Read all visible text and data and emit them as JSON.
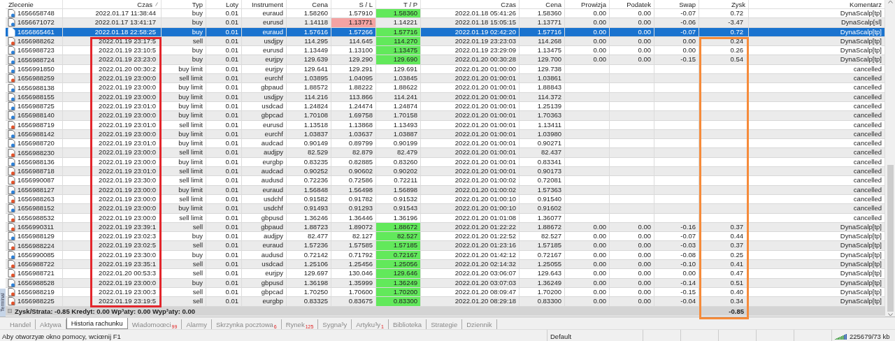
{
  "table": {
    "columns": [
      {
        "label": "Zlecenie",
        "sorted": false,
        "framed": false
      },
      {
        "label": "Czas",
        "sorted": true,
        "framed": true,
        "color": "#e3262c"
      },
      {
        "label": "Typ",
        "sorted": false,
        "framed": false
      },
      {
        "label": "Loty",
        "sorted": false,
        "framed": false
      },
      {
        "label": "Instrument",
        "sorted": false,
        "framed": false
      },
      {
        "label": "Cena",
        "sorted": false,
        "framed": false
      },
      {
        "label": "S / L",
        "sorted": false,
        "framed": false
      },
      {
        "label": "T / P",
        "sorted": false,
        "framed": false
      },
      {
        "label": "Czas",
        "sorted": false,
        "framed": false
      },
      {
        "label": "Cena",
        "sorted": false,
        "framed": false
      },
      {
        "label": "Prowizja",
        "sorted": false,
        "framed": false
      },
      {
        "label": "Podatek",
        "sorted": false,
        "framed": false
      },
      {
        "label": "Swap",
        "sorted": false,
        "framed": false
      },
      {
        "label": "Zysk",
        "sorted": false,
        "framed": true,
        "color": "#f68b3a"
      },
      {
        "label": "Komentarz",
        "sorted": false,
        "framed": false
      }
    ],
    "rows": [
      {
        "kind": "buy",
        "selected": false,
        "order": "1656658748",
        "open_time": "2022.01.17 11:38:44",
        "type": "buy",
        "lots": "0.01",
        "symbol": "euraud",
        "price": "1.58260",
        "sl": "1.57910",
        "sl_hit": false,
        "tp": "1.58360",
        "tp_hit": true,
        "close_time": "2022.01.18 05:41:26",
        "close_price": "1.58360",
        "commission": "0.00",
        "tax": "0.00",
        "swap": "-0.07",
        "profit": "0.72",
        "comment": "DynaScalp[tp]"
      },
      {
        "kind": "buy",
        "selected": false,
        "order": "1656671072",
        "open_time": "2022.01.17 13:41:17",
        "type": "buy",
        "lots": "0.01",
        "symbol": "eurusd",
        "price": "1.14118",
        "sl": "1.13771",
        "sl_hit": true,
        "tp": "1.14221",
        "tp_hit": false,
        "close_time": "2022.01.18 15:05:15",
        "close_price": "1.13771",
        "commission": "0.00",
        "tax": "0.00",
        "swap": "-0.06",
        "profit": "-3.47",
        "comment": "DynaScalp[sl]"
      },
      {
        "kind": "buy",
        "selected": true,
        "order": "1656865461",
        "open_time": "2022.01.18 22:58:25",
        "type": "buy",
        "lots": "0.01",
        "symbol": "euraud",
        "price": "1.57616",
        "sl": "1.57266",
        "sl_hit": false,
        "tp": "1.57716",
        "tp_hit": true,
        "close_time": "2022.01.19 02:42:20",
        "close_price": "1.57716",
        "commission": "0.00",
        "tax": "0.00",
        "swap": "-0.07",
        "profit": "0.72",
        "comment": "DynaScalp[tp]"
      },
      {
        "kind": "sell",
        "selected": false,
        "order": "1656988262",
        "open_time": "2022.01.19 23:17:5",
        "type": "sell",
        "lots": "0.01",
        "symbol": "usdjpy",
        "price": "114.295",
        "sl": "114.645",
        "sl_hit": false,
        "tp": "114.270",
        "tp_hit": true,
        "close_time": "2022.01.19 23:23:03",
        "close_price": "114.268",
        "commission": "0.00",
        "tax": "0.00",
        "swap": "0.00",
        "profit": "0.24",
        "comment": "DynaScalp[tp]"
      },
      {
        "kind": "buy",
        "selected": false,
        "order": "1656988723",
        "open_time": "2022.01.19 23:10:5",
        "type": "buy",
        "lots": "0.01",
        "symbol": "eurusd",
        "price": "1.13449",
        "sl": "1.13100",
        "sl_hit": false,
        "tp": "1.13475",
        "tp_hit": true,
        "close_time": "2022.01.19 23:29:09",
        "close_price": "1.13475",
        "commission": "0.00",
        "tax": "0.00",
        "swap": "0.00",
        "profit": "0.26",
        "comment": "DynaScalp[tp]"
      },
      {
        "kind": "buy",
        "selected": false,
        "order": "1656988724",
        "open_time": "2022.01.19 23:23:0",
        "type": "buy",
        "lots": "0.01",
        "symbol": "eurjpy",
        "price": "129.639",
        "sl": "129.290",
        "sl_hit": false,
        "tp": "129.690",
        "tp_hit": true,
        "close_time": "2022.01.20 00:30:28",
        "close_price": "129.700",
        "commission": "0.00",
        "tax": "0.00",
        "swap": "-0.15",
        "profit": "0.54",
        "comment": "DynaScalp[tp]"
      },
      {
        "kind": "buy",
        "selected": false,
        "order": "1656991850",
        "open_time": "2022.01.20 00:30:2",
        "type": "buy limit",
        "lots": "0.01",
        "symbol": "eurjpy",
        "price": "129.641",
        "sl": "129.291",
        "sl_hit": false,
        "tp": "129.691",
        "tp_hit": false,
        "close_time": "2022.01.20 01:00:00",
        "close_price": "129.738",
        "comment": "cancelled"
      },
      {
        "kind": "sell",
        "selected": false,
        "order": "1656988259",
        "open_time": "2022.01.19 23:00:0",
        "type": "sell limit",
        "lots": "0.01",
        "symbol": "eurchf",
        "price": "1.03895",
        "sl": "1.04095",
        "sl_hit": false,
        "tp": "1.03845",
        "tp_hit": false,
        "close_time": "2022.01.20 01:00:01",
        "close_price": "1.03861",
        "comment": "cancelled"
      },
      {
        "kind": "buy",
        "selected": false,
        "order": "1656988138",
        "open_time": "2022.01.19 23:00:0",
        "type": "buy limit",
        "lots": "0.01",
        "symbol": "gbpaud",
        "price": "1.88572",
        "sl": "1.88222",
        "sl_hit": false,
        "tp": "1.88622",
        "tp_hit": false,
        "close_time": "2022.01.20 01:00:01",
        "close_price": "1.88843",
        "comment": "cancelled"
      },
      {
        "kind": "buy",
        "selected": false,
        "order": "1656988155",
        "open_time": "2022.01.19 23:00:0",
        "type": "buy limit",
        "lots": "0.01",
        "symbol": "usdjpy",
        "price": "114.216",
        "sl": "113.866",
        "sl_hit": false,
        "tp": "114.241",
        "tp_hit": false,
        "close_time": "2022.01.20 01:00:01",
        "close_price": "114.372",
        "comment": "cancelled"
      },
      {
        "kind": "buy",
        "selected": false,
        "order": "1656988725",
        "open_time": "2022.01.19 23:01:0",
        "type": "buy limit",
        "lots": "0.01",
        "symbol": "usdcad",
        "price": "1.24824",
        "sl": "1.24474",
        "sl_hit": false,
        "tp": "1.24874",
        "tp_hit": false,
        "close_time": "2022.01.20 01:00:01",
        "close_price": "1.25139",
        "comment": "cancelled"
      },
      {
        "kind": "buy",
        "selected": false,
        "order": "1656988140",
        "open_time": "2022.01.19 23:00:0",
        "type": "buy limit",
        "lots": "0.01",
        "symbol": "gbpcad",
        "price": "1.70108",
        "sl": "1.69758",
        "sl_hit": false,
        "tp": "1.70158",
        "tp_hit": false,
        "close_time": "2022.01.20 01:00:01",
        "close_price": "1.70363",
        "comment": "cancelled"
      },
      {
        "kind": "sell",
        "selected": false,
        "order": "1656988719",
        "open_time": "2022.01.19 23:01:0",
        "type": "sell limit",
        "lots": "0.01",
        "symbol": "eurusd",
        "price": "1.13518",
        "sl": "1.13868",
        "sl_hit": false,
        "tp": "1.13493",
        "tp_hit": false,
        "close_time": "2022.01.20 01:00:01",
        "close_price": "1.13411",
        "comment": "cancelled"
      },
      {
        "kind": "buy",
        "selected": false,
        "order": "1656988142",
        "open_time": "2022.01.19 23:00:0",
        "type": "buy limit",
        "lots": "0.01",
        "symbol": "eurchf",
        "price": "1.03837",
        "sl": "1.03637",
        "sl_hit": false,
        "tp": "1.03887",
        "tp_hit": false,
        "close_time": "2022.01.20 01:00:01",
        "close_price": "1.03980",
        "comment": "cancelled"
      },
      {
        "kind": "buy",
        "selected": false,
        "order": "1656988720",
        "open_time": "2022.01.19 23:01:0",
        "type": "buy limit",
        "lots": "0.01",
        "symbol": "audcad",
        "price": "0.90149",
        "sl": "0.89799",
        "sl_hit": false,
        "tp": "0.90199",
        "tp_hit": false,
        "close_time": "2022.01.20 01:00:01",
        "close_price": "0.90271",
        "comment": "cancelled"
      },
      {
        "kind": "sell",
        "selected": false,
        "order": "1656988230",
        "open_time": "2022.01.19 23:00:0",
        "type": "sell limit",
        "lots": "0.01",
        "symbol": "audjpy",
        "price": "82.529",
        "sl": "82.879",
        "sl_hit": false,
        "tp": "82.479",
        "tp_hit": false,
        "close_time": "2022.01.20 01:00:01",
        "close_price": "82.437",
        "comment": "cancelled"
      },
      {
        "kind": "buy",
        "selected": false,
        "order": "1656988136",
        "open_time": "2022.01.19 23:00:0",
        "type": "buy limit",
        "lots": "0.01",
        "symbol": "eurgbp",
        "price": "0.83235",
        "sl": "0.82885",
        "sl_hit": false,
        "tp": "0.83260",
        "tp_hit": false,
        "close_time": "2022.01.20 01:00:01",
        "close_price": "0.83341",
        "comment": "cancelled"
      },
      {
        "kind": "sell",
        "selected": false,
        "order": "1656988718",
        "open_time": "2022.01.19 23:01:0",
        "type": "sell limit",
        "lots": "0.01",
        "symbol": "audcad",
        "price": "0.90252",
        "sl": "0.90602",
        "sl_hit": false,
        "tp": "0.90202",
        "tp_hit": false,
        "close_time": "2022.01.20 01:00:01",
        "close_price": "0.90173",
        "comment": "cancelled"
      },
      {
        "kind": "sell",
        "selected": false,
        "order": "1656990087",
        "open_time": "2022.01.19 23:30:0",
        "type": "sell limit",
        "lots": "0.01",
        "symbol": "audusd",
        "price": "0.72236",
        "sl": "0.72586",
        "sl_hit": false,
        "tp": "0.72211",
        "tp_hit": false,
        "close_time": "2022.01.20 01:00:02",
        "close_price": "0.72081",
        "comment": "cancelled"
      },
      {
        "kind": "buy",
        "selected": false,
        "order": "1656988127",
        "open_time": "2022.01.19 23:00:0",
        "type": "buy limit",
        "lots": "0.01",
        "symbol": "euraud",
        "price": "1.56848",
        "sl": "1.56498",
        "sl_hit": false,
        "tp": "1.56898",
        "tp_hit": false,
        "close_time": "2022.01.20 01:00:02",
        "close_price": "1.57363",
        "comment": "cancelled"
      },
      {
        "kind": "sell",
        "selected": false,
        "order": "1656988263",
        "open_time": "2022.01.19 23:00:0",
        "type": "sell limit",
        "lots": "0.01",
        "symbol": "usdchf",
        "price": "0.91582",
        "sl": "0.91782",
        "sl_hit": false,
        "tp": "0.91532",
        "tp_hit": false,
        "close_time": "2022.01.20 01:00:10",
        "close_price": "0.91540",
        "comment": "cancelled"
      },
      {
        "kind": "buy",
        "selected": false,
        "order": "1656988152",
        "open_time": "2022.01.19 23:00:0",
        "type": "buy limit",
        "lots": "0.01",
        "symbol": "usdchf",
        "price": "0.91493",
        "sl": "0.91293",
        "sl_hit": false,
        "tp": "0.91543",
        "tp_hit": false,
        "close_time": "2022.01.20 01:00:10",
        "close_price": "0.91602",
        "comment": "cancelled"
      },
      {
        "kind": "sell",
        "selected": false,
        "order": "1656988532",
        "open_time": "2022.01.19 23:00:0",
        "type": "sell limit",
        "lots": "0.01",
        "symbol": "gbpusd",
        "price": "1.36246",
        "sl": "1.36446",
        "sl_hit": false,
        "tp": "1.36196",
        "tp_hit": false,
        "close_time": "2022.01.20 01:01:08",
        "close_price": "1.36077",
        "comment": "cancelled"
      },
      {
        "kind": "sell",
        "selected": false,
        "order": "1656990311",
        "open_time": "2022.01.19 23:39:1",
        "type": "sell",
        "lots": "0.01",
        "symbol": "gbpaud",
        "price": "1.88723",
        "sl": "1.89072",
        "sl_hit": false,
        "tp": "1.88672",
        "tp_hit": true,
        "close_time": "2022.01.20 01:22:22",
        "close_price": "1.88672",
        "commission": "0.00",
        "tax": "0.00",
        "swap": "-0.16",
        "profit": "0.37",
        "comment": "DynaScalp[tp]"
      },
      {
        "kind": "buy",
        "selected": false,
        "order": "1656988129",
        "open_time": "2022.01.19 23:02:3",
        "type": "buy",
        "lots": "0.01",
        "symbol": "audjpy",
        "price": "82.477",
        "sl": "82.127",
        "sl_hit": false,
        "tp": "82.527",
        "tp_hit": true,
        "close_time": "2022.01.20 01:22:52",
        "close_price": "82.527",
        "commission": "0.00",
        "tax": "0.00",
        "swap": "-0.07",
        "profit": "0.44",
        "comment": "DynaScalp[tp]"
      },
      {
        "kind": "sell",
        "selected": false,
        "order": "1656988224",
        "open_time": "2022.01.19 23:02:5",
        "type": "sell",
        "lots": "0.01",
        "symbol": "euraud",
        "price": "1.57236",
        "sl": "1.57585",
        "sl_hit": false,
        "tp": "1.57185",
        "tp_hit": true,
        "close_time": "2022.01.20 01:23:16",
        "close_price": "1.57185",
        "commission": "0.00",
        "tax": "0.00",
        "swap": "-0.03",
        "profit": "0.37",
        "comment": "DynaScalp[tp]"
      },
      {
        "kind": "buy",
        "selected": false,
        "order": "1656990085",
        "open_time": "2022.01.19 23:30:0",
        "type": "buy",
        "lots": "0.01",
        "symbol": "audusd",
        "price": "0.72142",
        "sl": "0.71792",
        "sl_hit": false,
        "tp": "0.72167",
        "tp_hit": true,
        "close_time": "2022.01.20 01:42:12",
        "close_price": "0.72167",
        "commission": "0.00",
        "tax": "0.00",
        "swap": "-0.08",
        "profit": "0.25",
        "comment": "DynaScalp[tp]"
      },
      {
        "kind": "sell",
        "selected": false,
        "order": "1656988722",
        "open_time": "2022.01.19 23:35:1",
        "type": "sell",
        "lots": "0.01",
        "symbol": "usdcad",
        "price": "1.25106",
        "sl": "1.25456",
        "sl_hit": false,
        "tp": "1.25056",
        "tp_hit": true,
        "close_time": "2022.01.20 02:14:32",
        "close_price": "1.25055",
        "commission": "0.00",
        "tax": "0.00",
        "swap": "-0.10",
        "profit": "0.41",
        "comment": "DynaScalp[tp]"
      },
      {
        "kind": "sell",
        "selected": false,
        "order": "1656988721",
        "open_time": "2022.01.20 00:53:3",
        "type": "sell",
        "lots": "0.01",
        "symbol": "eurjpy",
        "price": "129.697",
        "sl": "130.046",
        "sl_hit": false,
        "tp": "129.646",
        "tp_hit": true,
        "close_time": "2022.01.20 03:06:07",
        "close_price": "129.643",
        "commission": "0.00",
        "tax": "0.00",
        "swap": "0.00",
        "profit": "0.47",
        "comment": "DynaScalp[tp]"
      },
      {
        "kind": "buy",
        "selected": false,
        "order": "1656988528",
        "open_time": "2022.01.19 23:00:0",
        "type": "buy",
        "lots": "0.01",
        "symbol": "gbpusd",
        "price": "1.36198",
        "sl": "1.35999",
        "sl_hit": false,
        "tp": "1.36249",
        "tp_hit": true,
        "close_time": "2022.01.20 03:07:03",
        "close_price": "1.36249",
        "commission": "0.00",
        "tax": "0.00",
        "swap": "-0.14",
        "profit": "0.51",
        "comment": "DynaScalp[tp]"
      },
      {
        "kind": "sell",
        "selected": false,
        "order": "1656988219",
        "open_time": "2022.01.19 23:00:3",
        "type": "sell",
        "lots": "0.01",
        "symbol": "gbpcad",
        "price": "1.70250",
        "sl": "1.70600",
        "sl_hit": false,
        "tp": "1.70200",
        "tp_hit": true,
        "close_time": "2022.01.20 08:09:47",
        "close_price": "1.70200",
        "commission": "0.00",
        "tax": "0.00",
        "swap": "-0.15",
        "profit": "0.40",
        "comment": "DynaScalp[tp]"
      },
      {
        "kind": "sell",
        "selected": false,
        "order": "1656988225",
        "open_time": "2022.01.19 23:19:5",
        "type": "sell",
        "lots": "0.01",
        "symbol": "eurgbp",
        "price": "0.83325",
        "sl": "0.83675",
        "sl_hit": false,
        "tp": "0.83300",
        "tp_hit": true,
        "close_time": "2022.01.20 08:29:18",
        "close_price": "0.83300",
        "commission": "0.00",
        "tax": "0.00",
        "swap": "-0.04",
        "profit": "0.34",
        "comment": "DynaScalp[tp]"
      }
    ],
    "summary": {
      "text": "Zysk/Strata: -0.85  Kredyt: 0.00  Wp³aty: 0.00  Wyp³aty: 0.00",
      "total": "-0.85"
    }
  },
  "panel_label": "Terminal",
  "tabs": [
    {
      "label": "Handel",
      "selected": false
    },
    {
      "label": "Aktywa",
      "selected": false
    },
    {
      "label": "Historia rachunku",
      "selected": true
    },
    {
      "label": "Wiadomoœci",
      "badge": "99",
      "selected": false
    },
    {
      "label": "Alarmy",
      "selected": false
    },
    {
      "label": "Skrzynka pocztowa",
      "badge": "6",
      "selected": false
    },
    {
      "label": "Rynek",
      "badge": "125",
      "selected": false
    },
    {
      "label": "Sygna³y",
      "selected": false
    },
    {
      "label": "Artyku³y",
      "badge": "1",
      "selected": false
    },
    {
      "label": "Biblioteka",
      "selected": false
    },
    {
      "label": "Strategie",
      "selected": false
    },
    {
      "label": "Dziennik",
      "selected": false
    }
  ],
  "status_bar": {
    "help_text": "Aby otworzyæ okno pomocy, wciœnij F1",
    "profile": "Default",
    "memory": "225679/73 kb"
  }
}
